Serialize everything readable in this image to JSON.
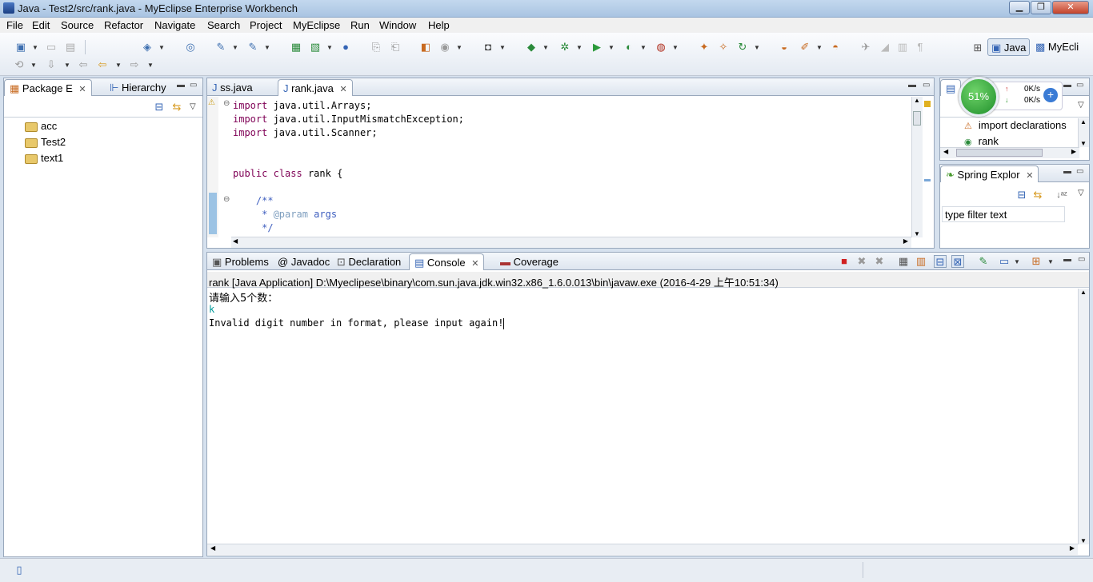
{
  "window": {
    "title": "Java - Test2/src/rank.java - MyEclipse Enterprise Workbench"
  },
  "menus": [
    "File",
    "Edit",
    "Source",
    "Refactor",
    "Navigate",
    "Search",
    "Project",
    "MyEclipse",
    "Run",
    "Window",
    "Help"
  ],
  "perspectives": {
    "java": "Java",
    "myeclipse": "MyEcli"
  },
  "package_explorer": {
    "tabs": [
      "Package E",
      "Hierarchy"
    ],
    "items": [
      "acc",
      "Test2",
      "text1"
    ]
  },
  "editor": {
    "tabs": [
      "ss.java",
      "rank.java"
    ],
    "lines": [
      "import java.util.Arrays;",
      "import java.util.InputMismatchException;",
      "import java.util.Scanner;",
      "",
      "public class rank {",
      "",
      "    /**",
      "     * @param args",
      "     */"
    ]
  },
  "outline": {
    "tab": "O",
    "items": [
      "import declarations",
      "rank"
    ]
  },
  "net_widget": {
    "percent": "51%",
    "up": "0K/s",
    "down": "0K/s"
  },
  "spring_explorer": {
    "tab": "Spring Explor",
    "filter_value": "type filter text"
  },
  "bottom_tabs": [
    "Problems",
    "Javadoc",
    "Declaration",
    "Console",
    "Coverage"
  ],
  "console": {
    "header": "rank [Java Application] D:\\Myeclipese\\binary\\com.sun.java.jdk.win32.x86_1.6.0.013\\bin\\javaw.exe (2016-4-29 上午10:51:34)",
    "lines": [
      "请输入5个数：",
      "k",
      "Invalid digit number in format, please input again!"
    ]
  },
  "colors": {
    "keyword": "#7f0055",
    "comment": "#3f5fbf",
    "input_text": "#009999"
  }
}
